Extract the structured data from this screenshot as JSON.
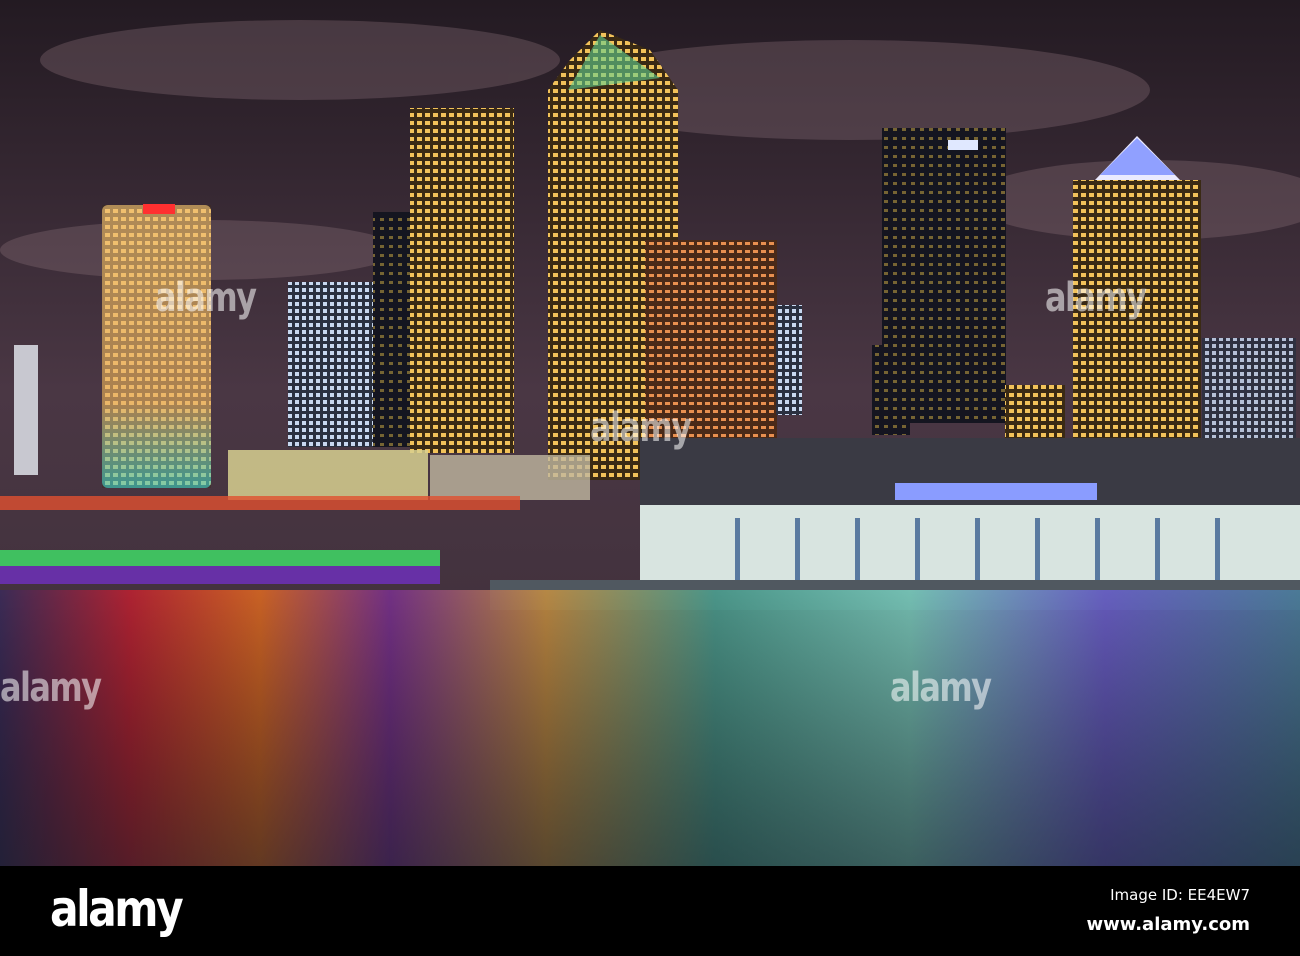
{
  "photo": {
    "subject": "Tampa city skyline at night over the Hillsborough River",
    "colors": {
      "sky_top": "#2a1f28",
      "sky_mid": "#5a4450",
      "water": "#2c5a5a",
      "gold": "#f2c25a",
      "blue_band": "#7b8cff"
    }
  },
  "watermark": {
    "text": "alamy"
  },
  "footer": {
    "logo": "alamy",
    "image_id": "Image ID: EE4EW7",
    "website": "www.alamy.com"
  }
}
